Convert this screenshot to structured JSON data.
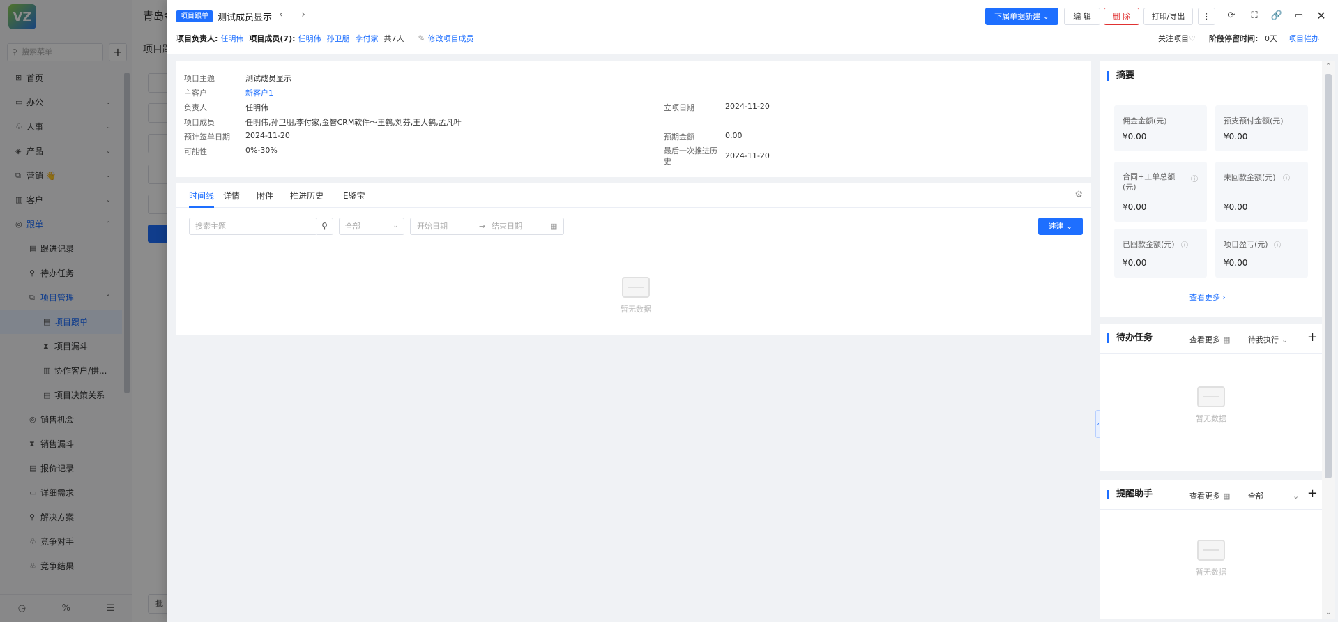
{
  "bg": {
    "logo": "VZ",
    "header_title": "青岛金",
    "subtitle": "项目跟",
    "search_placeholder": "搜索菜单",
    "nav": [
      {
        "label": "首页",
        "icon": "home-icon",
        "glyph": "⊞",
        "level": 0
      },
      {
        "label": "办公",
        "icon": "office-icon",
        "glyph": "▭",
        "level": 0,
        "chev": "⌄"
      },
      {
        "label": "人事",
        "icon": "people-icon",
        "glyph": "♧",
        "level": 0,
        "chev": "⌄"
      },
      {
        "label": "产品",
        "icon": "product-icon",
        "glyph": "◈",
        "level": 0,
        "chev": "⌄"
      },
      {
        "label": "营销 👋",
        "icon": "marketing-icon",
        "glyph": "⧉",
        "level": 0,
        "chev": "⌄"
      },
      {
        "label": "客户",
        "icon": "customer-icon",
        "glyph": "▥",
        "level": 0,
        "chev": "⌄"
      },
      {
        "label": "跟单",
        "icon": "follow-icon",
        "glyph": "◎",
        "level": 0,
        "chev": "⌃",
        "state": "active-group"
      },
      {
        "label": "跟进记录",
        "icon": "record-icon",
        "glyph": "▤",
        "level": 1
      },
      {
        "label": "待办任务",
        "icon": "todo-icon",
        "glyph": "⚲",
        "level": 1
      },
      {
        "label": "项目管理",
        "icon": "project-icon",
        "glyph": "⧉",
        "level": 1,
        "chev": "⌃",
        "state": "active-group"
      },
      {
        "label": "项目跟单",
        "icon": "project-follow-icon",
        "glyph": "▤",
        "level": 2,
        "state": "active"
      },
      {
        "label": "项目漏斗",
        "icon": "funnel-icon",
        "glyph": "⧗",
        "level": 2
      },
      {
        "label": "协作客户/供...",
        "icon": "partner-icon",
        "glyph": "▥",
        "level": 2
      },
      {
        "label": "项目决策关系",
        "icon": "decision-icon",
        "glyph": "▤",
        "level": 2
      },
      {
        "label": "销售机会",
        "icon": "opportunity-icon",
        "glyph": "◎",
        "level": 1
      },
      {
        "label": "销售漏斗",
        "icon": "sales-funnel-icon",
        "glyph": "⧗",
        "level": 1
      },
      {
        "label": "报价记录",
        "icon": "quote-icon",
        "glyph": "▤",
        "level": 1
      },
      {
        "label": "详细需求",
        "icon": "requirement-icon",
        "glyph": "▭",
        "level": 1
      },
      {
        "label": "解决方案",
        "icon": "solution-icon",
        "glyph": "⚲",
        "level": 1
      },
      {
        "label": "竞争对手",
        "icon": "competitor-icon",
        "glyph": "♧",
        "level": 1
      },
      {
        "label": "竞争结果",
        "icon": "result-icon",
        "glyph": "♧",
        "level": 1
      }
    ],
    "bottom_icons": [
      "◷",
      "%",
      "☰"
    ],
    "bottom_bar_label": "批"
  },
  "drawer": {
    "type_tag": "项目跟单",
    "title": "测试成员显示",
    "prev_icon": "‹",
    "next_icon": "›",
    "owner_label": "项目负责人:",
    "owner": "任明伟",
    "members_label": "项目成员(7):",
    "members": [
      "任明伟",
      "孙卫朋",
      "李付家"
    ],
    "members_total": "共7人",
    "edit_members": "修改项目成员",
    "buttons": {
      "new_child": "下属单据新建",
      "edit": "编 辑",
      "delete": "删 除",
      "print": "打印/导出"
    },
    "follow_label": "关注项目",
    "stage_label": "阶段停留时间:",
    "stage_value": "0天",
    "urge_label": "项目催办"
  },
  "info": {
    "left": [
      {
        "k": "项目主题",
        "v": "测试成员显示"
      },
      {
        "k": "主客户",
        "v": "新客户1",
        "link": true
      },
      {
        "k": "负责人",
        "v": "任明伟"
      },
      {
        "k": "项目成员",
        "v": "任明伟,孙卫朋,李付家,金智CRM软件～王鹤,刘芬,王大鹤,孟凡叶"
      },
      {
        "k": "预计签单日期",
        "v": "2024-11-20"
      },
      {
        "k": "可能性",
        "v": "0%-30%"
      }
    ],
    "right": [
      {
        "k": "立项日期",
        "v": "2024-11-20"
      },
      {
        "k": "预期金额",
        "v": "0.00"
      },
      {
        "k": "最后一次推进历史",
        "v": "2024-11-20"
      }
    ]
  },
  "tabs": [
    "时间线",
    "详情",
    "附件",
    "推进历史",
    "E鉴宝"
  ],
  "filters": {
    "search_placeholder": "搜索主题",
    "select_value": "全部",
    "date_start": "开始日期",
    "date_sep": "→",
    "date_end": "结束日期",
    "quick_btn": "速建"
  },
  "empty_text": "暂无数据",
  "summary": {
    "title": "摘要",
    "stats": [
      {
        "label": "佣金金额(元)",
        "value": "¥0.00"
      },
      {
        "label": "预支预付金额(元)",
        "value": "¥0.00"
      },
      {
        "label": "合同+工单总额(元)",
        "value": "¥0.00",
        "help": true
      },
      {
        "label": "未回款金额(元)",
        "value": "¥0.00",
        "help": true
      },
      {
        "label": "已回款金额(元)",
        "value": "¥0.00",
        "help": true
      },
      {
        "label": "项目盈亏(元)",
        "value": "¥0.00",
        "help": true
      }
    ],
    "view_more": "查看更多"
  },
  "todo": {
    "title": "待办任务",
    "view_more": "查看更多",
    "filter": "待我执行"
  },
  "reminder": {
    "title": "提醒助手",
    "view_more": "查看更多",
    "filter": "全部"
  }
}
